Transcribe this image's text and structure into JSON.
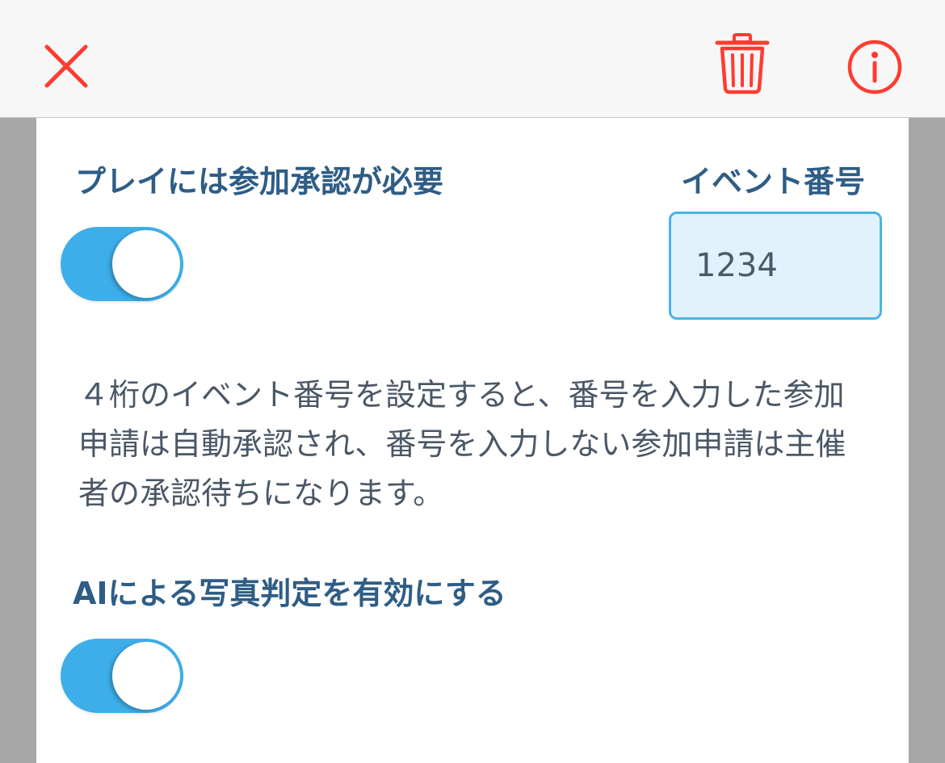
{
  "header": {
    "close_icon": "close-icon",
    "trash_icon": "trash-icon",
    "info_icon": "info-icon",
    "accent_color": "#ff3b30"
  },
  "settings": {
    "approval_label": "プレイには参加承認が必要",
    "approval_enabled": true,
    "event_number_label": "イベント番号",
    "event_number_value": "1234",
    "description": "４桁のイベント番号を設定すると、番号を入力した参加申請は自動承認され、番号を入力しない参加申請は主催者の承認待ちになります。",
    "ai_label": "AIによる写真判定を有効にする",
    "ai_enabled": true,
    "toggle_color": "#3daee9",
    "label_color": "#2e5d86"
  }
}
